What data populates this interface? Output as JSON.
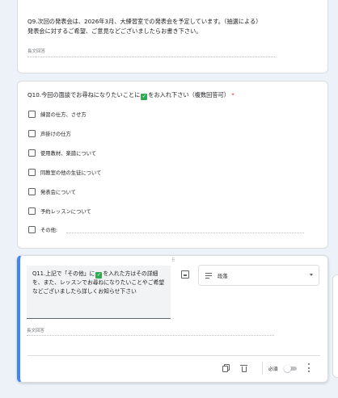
{
  "q9": {
    "line1": "Q9.次回の発表会は、2026年3月、大練習室での発表会を予定しています。（抽選による）",
    "line2": "発表会に対するご希望、ご意見などございましたらお書き下さい。",
    "answer_placeholder": "長文回答"
  },
  "q10": {
    "title_before": "Q10.今回の面談でお尋ねになりたいことに",
    "emoji": "✓",
    "title_after": "をお入れ下さい（複数回答可）",
    "required_mark": "*",
    "options": [
      "練習の仕方、させ方",
      "声掛けの仕方",
      "使用教材、楽譜について",
      "同教室の他の生徒について",
      "発表会について",
      "予約レッスンについて",
      "その他:"
    ]
  },
  "q11": {
    "drag_handle": "⠿",
    "text_before": "Q11.上記で「その他」に",
    "emoji": "✓",
    "text_after": "を入れた方はその詳細を、また、レッスンでお尋ねになりたいことやご希望などございましたら詳しくお知らせ下さい",
    "question_type": "段落",
    "answer_placeholder": "長文回答",
    "required_label": "必須",
    "required_on": false,
    "icons": [
      "image-icon",
      "paragraph-lines-icon",
      "dropdown-caret-icon",
      "duplicate-icon",
      "delete-icon",
      "toggle-switch",
      "more-vert-icon"
    ]
  },
  "colors": {
    "accent": "#4285f4",
    "required": "#d93025",
    "emoji_bg": "#34a853",
    "page_bg": "#edf2f9"
  }
}
